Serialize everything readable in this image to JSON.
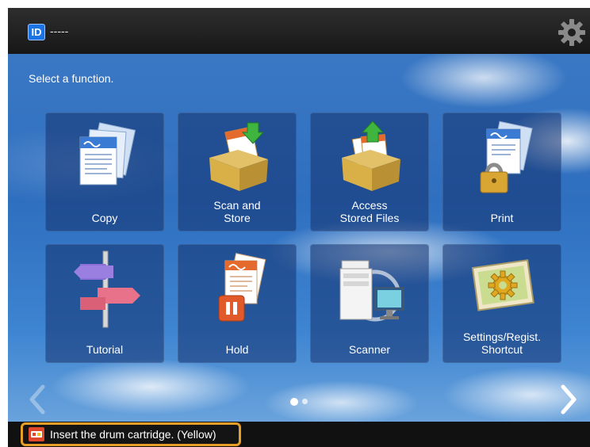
{
  "header": {
    "id_badge": "ID",
    "user": "-----",
    "settings_icon": "gear-icon"
  },
  "main": {
    "instruction": "Select a function.",
    "tiles": [
      {
        "label": "Copy",
        "icon": "copy-icon"
      },
      {
        "label": "Scan and\nStore",
        "icon": "scan-and-store-icon"
      },
      {
        "label": "Access\nStored Files",
        "icon": "access-stored-files-icon"
      },
      {
        "label": "Print",
        "icon": "print-icon"
      },
      {
        "label": "Tutorial",
        "icon": "tutorial-signpost-icon"
      },
      {
        "label": "Hold",
        "icon": "hold-icon"
      },
      {
        "label": "Scanner",
        "icon": "scanner-icon"
      },
      {
        "label": "Settings/Regist.\nShortcut",
        "icon": "settings-shortcut-icon"
      }
    ],
    "page_indicator": {
      "current": 1,
      "total": 2
    },
    "nav": {
      "prev_icon": "chevron-left-icon",
      "next_icon": "chevron-right-icon"
    }
  },
  "status": {
    "message": "Insert the drum cartridge. (Yellow)",
    "icon": "drum-cartridge-alert-icon",
    "accent": "#e79f27"
  }
}
